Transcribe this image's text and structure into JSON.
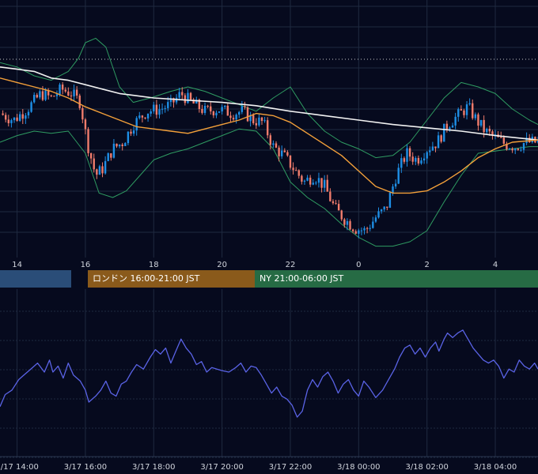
{
  "colors": {
    "background": "#060a1e",
    "grid": "#1f2a40",
    "candle_up": "#1e8fe6",
    "candle_down": "#f07c6c",
    "ma_short": "#f3a03a",
    "ma_long": "#f2f2f2",
    "band": "#2f9c62",
    "oscillator": "#5a63e6",
    "session_tokyo": "#2a4d78",
    "session_london": "#8a5a1b",
    "session_ny": "#266b44",
    "axis_text": "#d0d4dc",
    "dotted_ref": "#c8c8c8"
  },
  "sessions": [
    {
      "label": "",
      "start": 7.0,
      "end": 14.5,
      "color": "#2a4d78"
    },
    {
      "label": "ロンドン 16:00-21:00 JST",
      "start": 16.0,
      "end": 21.0,
      "color": "#8a5a1b"
    },
    {
      "label": "NY 21:00-06:00 JST",
      "start": 21.0,
      "end": 30.0,
      "color": "#266b44"
    }
  ],
  "chart_data": [
    {
      "type": "candlestick",
      "title": "",
      "xlabel": "",
      "ylabel": "",
      "x_unit": "hours",
      "xlim": [
        13.5,
        29.25
      ],
      "ylim": [
        0.0,
        1.0
      ],
      "x_ticks": [
        14,
        16,
        18,
        20,
        22,
        24,
        26,
        28
      ],
      "x_tick_labels": [
        "14",
        "16",
        "18",
        "20",
        "22",
        "0",
        "2",
        "4"
      ],
      "grid": true,
      "reference_line": 0.875,
      "price_path": [
        [
          13.5,
          0.63
        ],
        [
          13.9,
          0.6
        ],
        [
          14.3,
          0.65
        ],
        [
          14.7,
          0.72
        ],
        [
          15.0,
          0.7
        ],
        [
          15.3,
          0.74
        ],
        [
          15.6,
          0.72
        ],
        [
          15.85,
          0.68
        ],
        [
          16.05,
          0.5
        ],
        [
          16.3,
          0.35
        ],
        [
          16.5,
          0.38
        ],
        [
          16.8,
          0.47
        ],
        [
          17.1,
          0.5
        ],
        [
          17.4,
          0.58
        ],
        [
          17.8,
          0.64
        ],
        [
          18.2,
          0.65
        ],
        [
          18.5,
          0.67
        ],
        [
          18.8,
          0.72
        ],
        [
          19.1,
          0.68
        ],
        [
          19.5,
          0.64
        ],
        [
          19.9,
          0.65
        ],
        [
          20.3,
          0.63
        ],
        [
          20.6,
          0.64
        ],
        [
          20.9,
          0.6
        ],
        [
          21.2,
          0.59
        ],
        [
          21.5,
          0.48
        ],
        [
          21.8,
          0.44
        ],
        [
          22.1,
          0.38
        ],
        [
          22.4,
          0.32
        ],
        [
          22.7,
          0.35
        ],
        [
          23.0,
          0.3
        ],
        [
          23.3,
          0.2
        ],
        [
          23.6,
          0.15
        ],
        [
          23.9,
          0.11
        ],
        [
          24.2,
          0.1
        ],
        [
          24.5,
          0.16
        ],
        [
          24.8,
          0.2
        ],
        [
          25.1,
          0.35
        ],
        [
          25.4,
          0.45
        ],
        [
          25.7,
          0.42
        ],
        [
          26.0,
          0.47
        ],
        [
          26.3,
          0.5
        ],
        [
          26.6,
          0.58
        ],
        [
          26.9,
          0.62
        ],
        [
          27.2,
          0.66
        ],
        [
          27.45,
          0.6
        ],
        [
          27.7,
          0.55
        ],
        [
          28.0,
          0.52
        ],
        [
          28.3,
          0.49
        ],
        [
          28.6,
          0.48
        ],
        [
          28.9,
          0.5
        ],
        [
          29.25,
          0.5
        ]
      ],
      "ma_short": [
        [
          13.5,
          0.79
        ],
        [
          14.0,
          0.77
        ],
        [
          14.5,
          0.75
        ],
        [
          15.0,
          0.73
        ],
        [
          15.5,
          0.7
        ],
        [
          16.0,
          0.66
        ],
        [
          16.5,
          0.63
        ],
        [
          17.0,
          0.6
        ],
        [
          17.5,
          0.57
        ],
        [
          18.0,
          0.56
        ],
        [
          18.5,
          0.55
        ],
        [
          19.0,
          0.54
        ],
        [
          19.5,
          0.56
        ],
        [
          20.0,
          0.58
        ],
        [
          20.5,
          0.6
        ],
        [
          21.0,
          0.63
        ],
        [
          21.5,
          0.62
        ],
        [
          22.0,
          0.59
        ],
        [
          22.5,
          0.54
        ],
        [
          23.0,
          0.49
        ],
        [
          23.5,
          0.44
        ],
        [
          24.0,
          0.37
        ],
        [
          24.5,
          0.3
        ],
        [
          25.0,
          0.27
        ],
        [
          25.5,
          0.27
        ],
        [
          26.0,
          0.28
        ],
        [
          26.5,
          0.32
        ],
        [
          27.0,
          0.37
        ],
        [
          27.5,
          0.43
        ],
        [
          28.0,
          0.47
        ],
        [
          28.5,
          0.5
        ],
        [
          29.25,
          0.51
        ]
      ],
      "ma_long": [
        [
          13.5,
          0.84
        ],
        [
          14.0,
          0.83
        ],
        [
          14.5,
          0.82
        ],
        [
          15.0,
          0.79
        ],
        [
          15.5,
          0.78
        ],
        [
          16.0,
          0.76
        ],
        [
          16.5,
          0.74
        ],
        [
          17.0,
          0.72
        ],
        [
          17.5,
          0.71
        ],
        [
          18.0,
          0.7
        ],
        [
          19.0,
          0.69
        ],
        [
          20.0,
          0.68
        ],
        [
          21.0,
          0.665
        ],
        [
          22.0,
          0.64
        ],
        [
          23.0,
          0.62
        ],
        [
          24.0,
          0.6
        ],
        [
          25.0,
          0.58
        ],
        [
          26.0,
          0.565
        ],
        [
          27.0,
          0.55
        ],
        [
          28.0,
          0.53
        ],
        [
          29.25,
          0.51
        ]
      ],
      "band_upper": [
        [
          13.5,
          0.86
        ],
        [
          14.0,
          0.84
        ],
        [
          14.5,
          0.8
        ],
        [
          15.0,
          0.78
        ],
        [
          15.5,
          0.82
        ],
        [
          15.8,
          0.88
        ],
        [
          16.0,
          0.95
        ],
        [
          16.3,
          0.97
        ],
        [
          16.6,
          0.93
        ],
        [
          17.0,
          0.75
        ],
        [
          17.4,
          0.68
        ],
        [
          17.9,
          0.7
        ],
        [
          18.5,
          0.73
        ],
        [
          19.0,
          0.75
        ],
        [
          19.5,
          0.73
        ],
        [
          20.0,
          0.7
        ],
        [
          20.5,
          0.67
        ],
        [
          21.0,
          0.64
        ],
        [
          21.5,
          0.7
        ],
        [
          22.0,
          0.75
        ],
        [
          22.5,
          0.63
        ],
        [
          23.0,
          0.55
        ],
        [
          23.5,
          0.5
        ],
        [
          24.0,
          0.47
        ],
        [
          24.5,
          0.43
        ],
        [
          25.0,
          0.44
        ],
        [
          25.5,
          0.5
        ],
        [
          26.0,
          0.6
        ],
        [
          26.5,
          0.7
        ],
        [
          27.0,
          0.77
        ],
        [
          27.5,
          0.75
        ],
        [
          28.0,
          0.72
        ],
        [
          28.5,
          0.65
        ],
        [
          29.0,
          0.6
        ],
        [
          29.25,
          0.58
        ]
      ],
      "band_lower": [
        [
          13.5,
          0.5
        ],
        [
          14.0,
          0.53
        ],
        [
          14.5,
          0.55
        ],
        [
          15.0,
          0.54
        ],
        [
          15.5,
          0.55
        ],
        [
          16.0,
          0.45
        ],
        [
          16.4,
          0.27
        ],
        [
          16.8,
          0.25
        ],
        [
          17.2,
          0.28
        ],
        [
          17.6,
          0.35
        ],
        [
          18.0,
          0.42
        ],
        [
          18.5,
          0.45
        ],
        [
          19.0,
          0.47
        ],
        [
          19.5,
          0.5
        ],
        [
          20.0,
          0.53
        ],
        [
          20.5,
          0.56
        ],
        [
          21.0,
          0.55
        ],
        [
          21.5,
          0.47
        ],
        [
          22.0,
          0.32
        ],
        [
          22.5,
          0.25
        ],
        [
          23.0,
          0.2
        ],
        [
          23.5,
          0.13
        ],
        [
          24.0,
          0.07
        ],
        [
          24.5,
          0.03
        ],
        [
          25.0,
          0.03
        ],
        [
          25.5,
          0.05
        ],
        [
          26.0,
          0.1
        ],
        [
          26.5,
          0.23
        ],
        [
          27.0,
          0.35
        ],
        [
          27.5,
          0.45
        ],
        [
          28.0,
          0.46
        ],
        [
          28.5,
          0.47
        ],
        [
          29.0,
          0.48
        ],
        [
          29.25,
          0.48
        ]
      ]
    },
    {
      "type": "line",
      "title": "",
      "xlabel": "",
      "ylabel": "",
      "x_unit": "hours",
      "xlim": [
        13.5,
        29.25
      ],
      "ylim": [
        0.0,
        1.0
      ],
      "x_ticks": [
        14,
        16,
        18,
        20,
        22,
        24,
        26,
        28
      ],
      "x_tick_labels": [
        "3/17 14:00",
        "3/17 16:00",
        "3/17 18:00",
        "3/17 20:00",
        "3/17 22:00",
        "3/18 00:00",
        "3/18 02:00",
        "3/18 04:00"
      ],
      "grid": true,
      "series": [
        {
          "points": [
            [
              13.5,
              0.27
            ],
            [
              13.65,
              0.35
            ],
            [
              13.85,
              0.38
            ],
            [
              14.05,
              0.45
            ],
            [
              14.2,
              0.48
            ],
            [
              14.4,
              0.52
            ],
            [
              14.6,
              0.56
            ],
            [
              14.8,
              0.5
            ],
            [
              14.95,
              0.58
            ],
            [
              15.05,
              0.5
            ],
            [
              15.2,
              0.54
            ],
            [
              15.35,
              0.46
            ],
            [
              15.5,
              0.56
            ],
            [
              15.65,
              0.48
            ],
            [
              15.85,
              0.44
            ],
            [
              16.0,
              0.38
            ],
            [
              16.1,
              0.3
            ],
            [
              16.3,
              0.34
            ],
            [
              16.45,
              0.38
            ],
            [
              16.6,
              0.44
            ],
            [
              16.75,
              0.36
            ],
            [
              16.9,
              0.34
            ],
            [
              17.05,
              0.42
            ],
            [
              17.2,
              0.44
            ],
            [
              17.35,
              0.5
            ],
            [
              17.5,
              0.55
            ],
            [
              17.7,
              0.52
            ],
            [
              17.9,
              0.6
            ],
            [
              18.05,
              0.65
            ],
            [
              18.2,
              0.62
            ],
            [
              18.35,
              0.66
            ],
            [
              18.5,
              0.56
            ],
            [
              18.65,
              0.64
            ],
            [
              18.8,
              0.72
            ],
            [
              18.95,
              0.66
            ],
            [
              19.1,
              0.62
            ],
            [
              19.25,
              0.55
            ],
            [
              19.4,
              0.57
            ],
            [
              19.55,
              0.5
            ],
            [
              19.7,
              0.53
            ],
            [
              19.85,
              0.52
            ],
            [
              20.0,
              0.51
            ],
            [
              20.2,
              0.5
            ],
            [
              20.4,
              0.53
            ],
            [
              20.55,
              0.56
            ],
            [
              20.7,
              0.5
            ],
            [
              20.85,
              0.54
            ],
            [
              21.0,
              0.53
            ],
            [
              21.15,
              0.48
            ],
            [
              21.3,
              0.42
            ],
            [
              21.45,
              0.36
            ],
            [
              21.6,
              0.4
            ],
            [
              21.75,
              0.34
            ],
            [
              21.9,
              0.32
            ],
            [
              22.05,
              0.28
            ],
            [
              22.2,
              0.2
            ],
            [
              22.35,
              0.24
            ],
            [
              22.5,
              0.38
            ],
            [
              22.65,
              0.45
            ],
            [
              22.8,
              0.4
            ],
            [
              22.95,
              0.47
            ],
            [
              23.1,
              0.5
            ],
            [
              23.25,
              0.44
            ],
            [
              23.4,
              0.36
            ],
            [
              23.55,
              0.42
            ],
            [
              23.7,
              0.45
            ],
            [
              23.85,
              0.38
            ],
            [
              24.0,
              0.34
            ],
            [
              24.15,
              0.44
            ],
            [
              24.3,
              0.4
            ],
            [
              24.5,
              0.33
            ],
            [
              24.7,
              0.38
            ],
            [
              24.9,
              0.46
            ],
            [
              25.05,
              0.52
            ],
            [
              25.2,
              0.6
            ],
            [
              25.35,
              0.66
            ],
            [
              25.5,
              0.68
            ],
            [
              25.65,
              0.62
            ],
            [
              25.8,
              0.66
            ],
            [
              25.95,
              0.6
            ],
            [
              26.1,
              0.66
            ],
            [
              26.25,
              0.7
            ],
            [
              26.35,
              0.64
            ],
            [
              26.5,
              0.72
            ],
            [
              26.6,
              0.76
            ],
            [
              26.75,
              0.73
            ],
            [
              26.9,
              0.76
            ],
            [
              27.05,
              0.78
            ],
            [
              27.2,
              0.72
            ],
            [
              27.35,
              0.66
            ],
            [
              27.5,
              0.62
            ],
            [
              27.65,
              0.58
            ],
            [
              27.8,
              0.56
            ],
            [
              27.95,
              0.58
            ],
            [
              28.1,
              0.54
            ],
            [
              28.25,
              0.46
            ],
            [
              28.4,
              0.52
            ],
            [
              28.55,
              0.5
            ],
            [
              28.7,
              0.58
            ],
            [
              28.85,
              0.54
            ],
            [
              29.0,
              0.52
            ],
            [
              29.15,
              0.56
            ],
            [
              29.25,
              0.52
            ]
          ]
        }
      ]
    }
  ]
}
